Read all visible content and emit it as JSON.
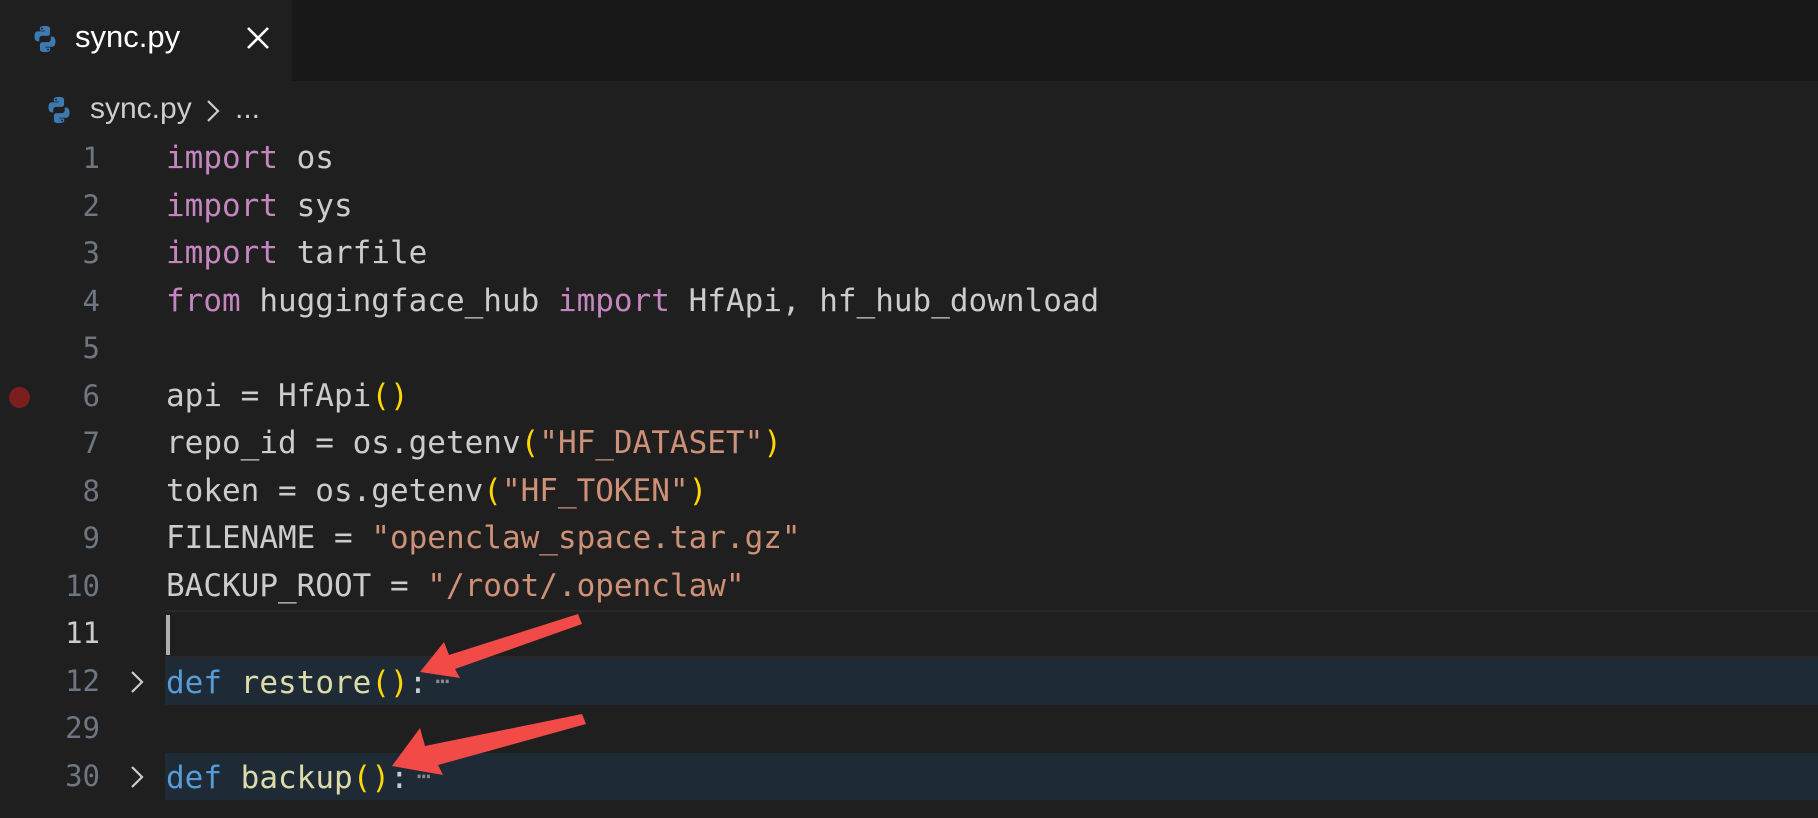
{
  "tab": {
    "title": "sync.py",
    "icon": "python-icon",
    "close_icon": "close-icon"
  },
  "breadcrumb": {
    "file": "sync.py",
    "ellipsis": "..."
  },
  "colors": {
    "background": "#1f1f1f",
    "keyword": "#c586c0",
    "def_keyword": "#569cd6",
    "function": "#dcdcaa",
    "string": "#ce9178",
    "bracket": "#ffd700",
    "breakpoint": "#7a1e1e",
    "arrow": "#f24b47"
  },
  "lines": [
    {
      "n": "1",
      "t": [
        "import",
        " os"
      ]
    },
    {
      "n": "2",
      "t": [
        "import",
        " sys"
      ]
    },
    {
      "n": "3",
      "t": [
        "import",
        " tarfile"
      ]
    },
    {
      "n": "4",
      "t": [
        "from",
        " huggingface_hub ",
        "import",
        " HfApi, hf_hub_download"
      ]
    },
    {
      "n": "5"
    },
    {
      "n": "6",
      "t": [
        "api = HfApi",
        "()"
      ]
    },
    {
      "n": "7",
      "t": [
        "repo_id = os.getenv",
        "(",
        "\"HF_DATASET\"",
        ")"
      ]
    },
    {
      "n": "8",
      "t": [
        "token = os.getenv",
        "(",
        "\"HF_TOKEN\"",
        ")"
      ]
    },
    {
      "n": "9",
      "t": [
        "FILENAME = ",
        "\"openclaw_space.tar.gz\""
      ]
    },
    {
      "n": "10",
      "t": [
        "BACKUP_ROOT = ",
        "\"/root/.openclaw\""
      ]
    },
    {
      "n": "11"
    },
    {
      "n": "12",
      "t": [
        "def",
        " ",
        "restore",
        "()",
        ":"
      ],
      "folded": "⋯"
    },
    {
      "n": "29"
    },
    {
      "n": "30",
      "t": [
        "def",
        " ",
        "backup",
        "()",
        ":"
      ],
      "folded": "⋯"
    }
  ]
}
